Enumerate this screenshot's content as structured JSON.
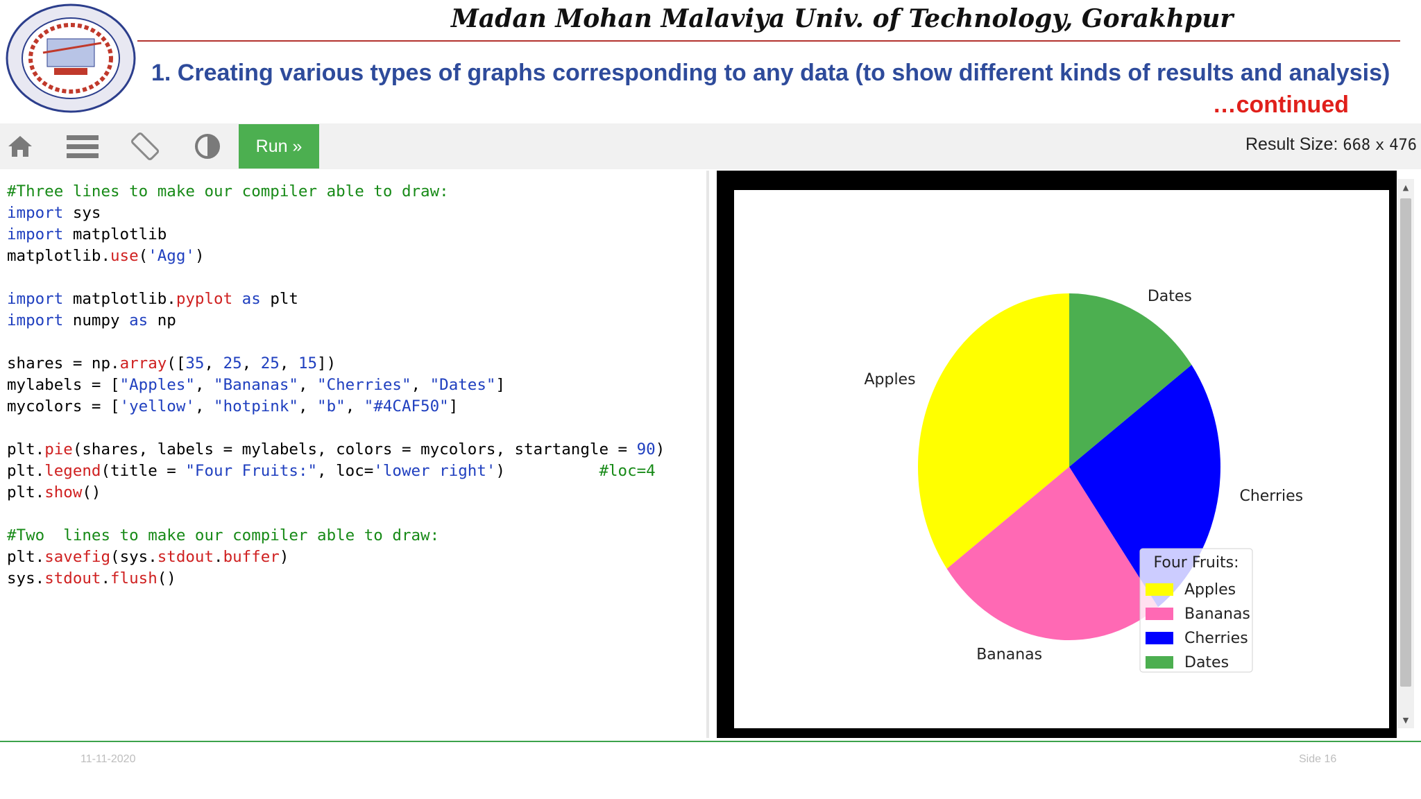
{
  "slide": {
    "university": "Madan Mohan Malaviya Univ. of Technology, Gorakhpur",
    "heading": "1. Creating various types of graphs corresponding to any data (to show different kinds of results and analysis)",
    "continued": "…continued",
    "footer_date": "11-11-2020",
    "footer_slide": "Side 16",
    "logo_icon": "university-seal-icon"
  },
  "toolbar": {
    "icons": [
      "home-icon",
      "menu-icon",
      "rotate-icon",
      "contrast-icon"
    ],
    "run_label": "Run »",
    "result_size_label": "Result Size:",
    "result_width": "668",
    "result_x": "x",
    "result_height": "476"
  },
  "code": {
    "lines": [
      "#Three lines to make our compiler able to draw:",
      "import sys",
      "import matplotlib",
      "matplotlib.use('Agg')",
      "",
      "import matplotlib.pyplot as plt",
      "import numpy as np",
      "",
      "shares = np.array([35, 25, 25, 15])",
      "mylabels = [\"Apples\", \"Bananas\", \"Cherries\", \"Dates\"]",
      "mycolors = ['yellow', \"hotpink\", \"b\", \"#4CAF50\"]",
      "",
      "plt.pie(shares, labels = mylabels, colors = mycolors, startangle = 90)",
      "plt.legend(title = \"Four Fruits:\", loc='lower right')          #loc=4",
      "plt.show()",
      "",
      "#Two  lines to make our compiler able to draw:",
      "plt.savefig(sys.stdout.buffer)",
      "sys.stdout.flush()"
    ]
  },
  "chart_data": {
    "type": "pie",
    "categories": [
      "Apples",
      "Bananas",
      "Cherries",
      "Dates"
    ],
    "values": [
      35,
      25,
      25,
      15
    ],
    "colors": [
      "#ffff00",
      "#ff69b4",
      "#0000ff",
      "#4caf50"
    ],
    "startangle": 90,
    "legend": {
      "title": "Four Fruits:",
      "placement": "lower right"
    }
  }
}
